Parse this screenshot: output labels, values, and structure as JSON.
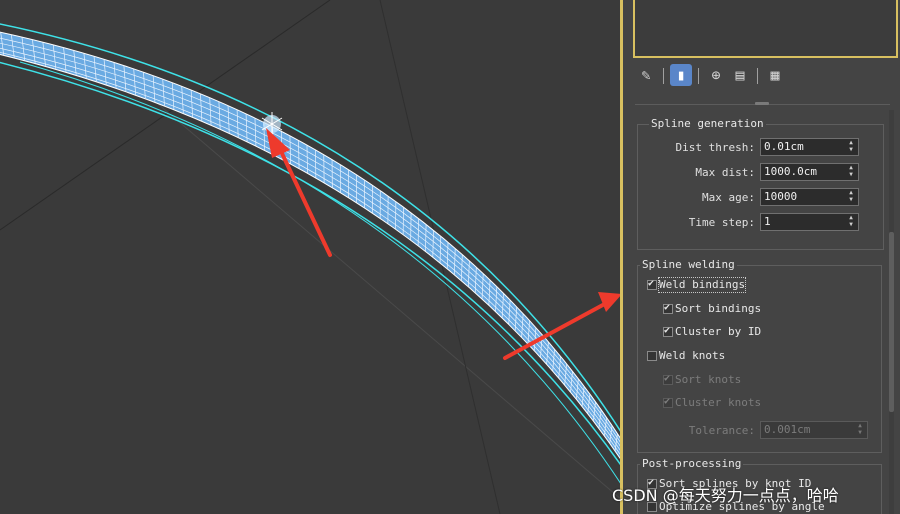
{
  "viewport": {
    "background": "#3a3a3a",
    "tube_color": "#6aaae2",
    "wire_color": "#3ee2e8",
    "arrow_color": "#ee3a2c"
  },
  "toolbar": {
    "icons": [
      "pin-icon",
      "modifier-stack-icon",
      "make-unique-icon",
      "delete-icon",
      "configure-icon"
    ],
    "active_index": 1
  },
  "spline_generation": {
    "title": "Spline generation",
    "fields": [
      {
        "label": "Dist thresh:",
        "value": "0.01cm"
      },
      {
        "label": "Max dist:",
        "value": "1000.0cm"
      },
      {
        "label": "Max age:",
        "value": "10000"
      },
      {
        "label": "Time step:",
        "value": "1"
      }
    ]
  },
  "spline_welding": {
    "title": "Spline welding",
    "weld_bindings": {
      "label": "Weld bindings",
      "checked": true
    },
    "sort_bindings": {
      "label": "Sort bindings",
      "checked": true
    },
    "cluster_by_id": {
      "label": "Cluster by ID",
      "checked": true
    },
    "weld_knots": {
      "label": "Weld knots",
      "checked": false
    },
    "sort_knots": {
      "label": "Sort knots",
      "checked": true,
      "disabled": true
    },
    "cluster_knots": {
      "label": "Cluster knots",
      "checked": true,
      "disabled": true
    },
    "tolerance": {
      "label": "Tolerance:",
      "value": "0.001cm",
      "disabled": true
    }
  },
  "post_processing": {
    "title": "Post-processing",
    "sort_splines": {
      "label": "Sort splines by knot ID",
      "checked": true
    },
    "optimize_splines": {
      "label": "Optimize splines by angle",
      "checked": false
    }
  },
  "watermark": "CSDN @每天努力一点点，哈哈"
}
